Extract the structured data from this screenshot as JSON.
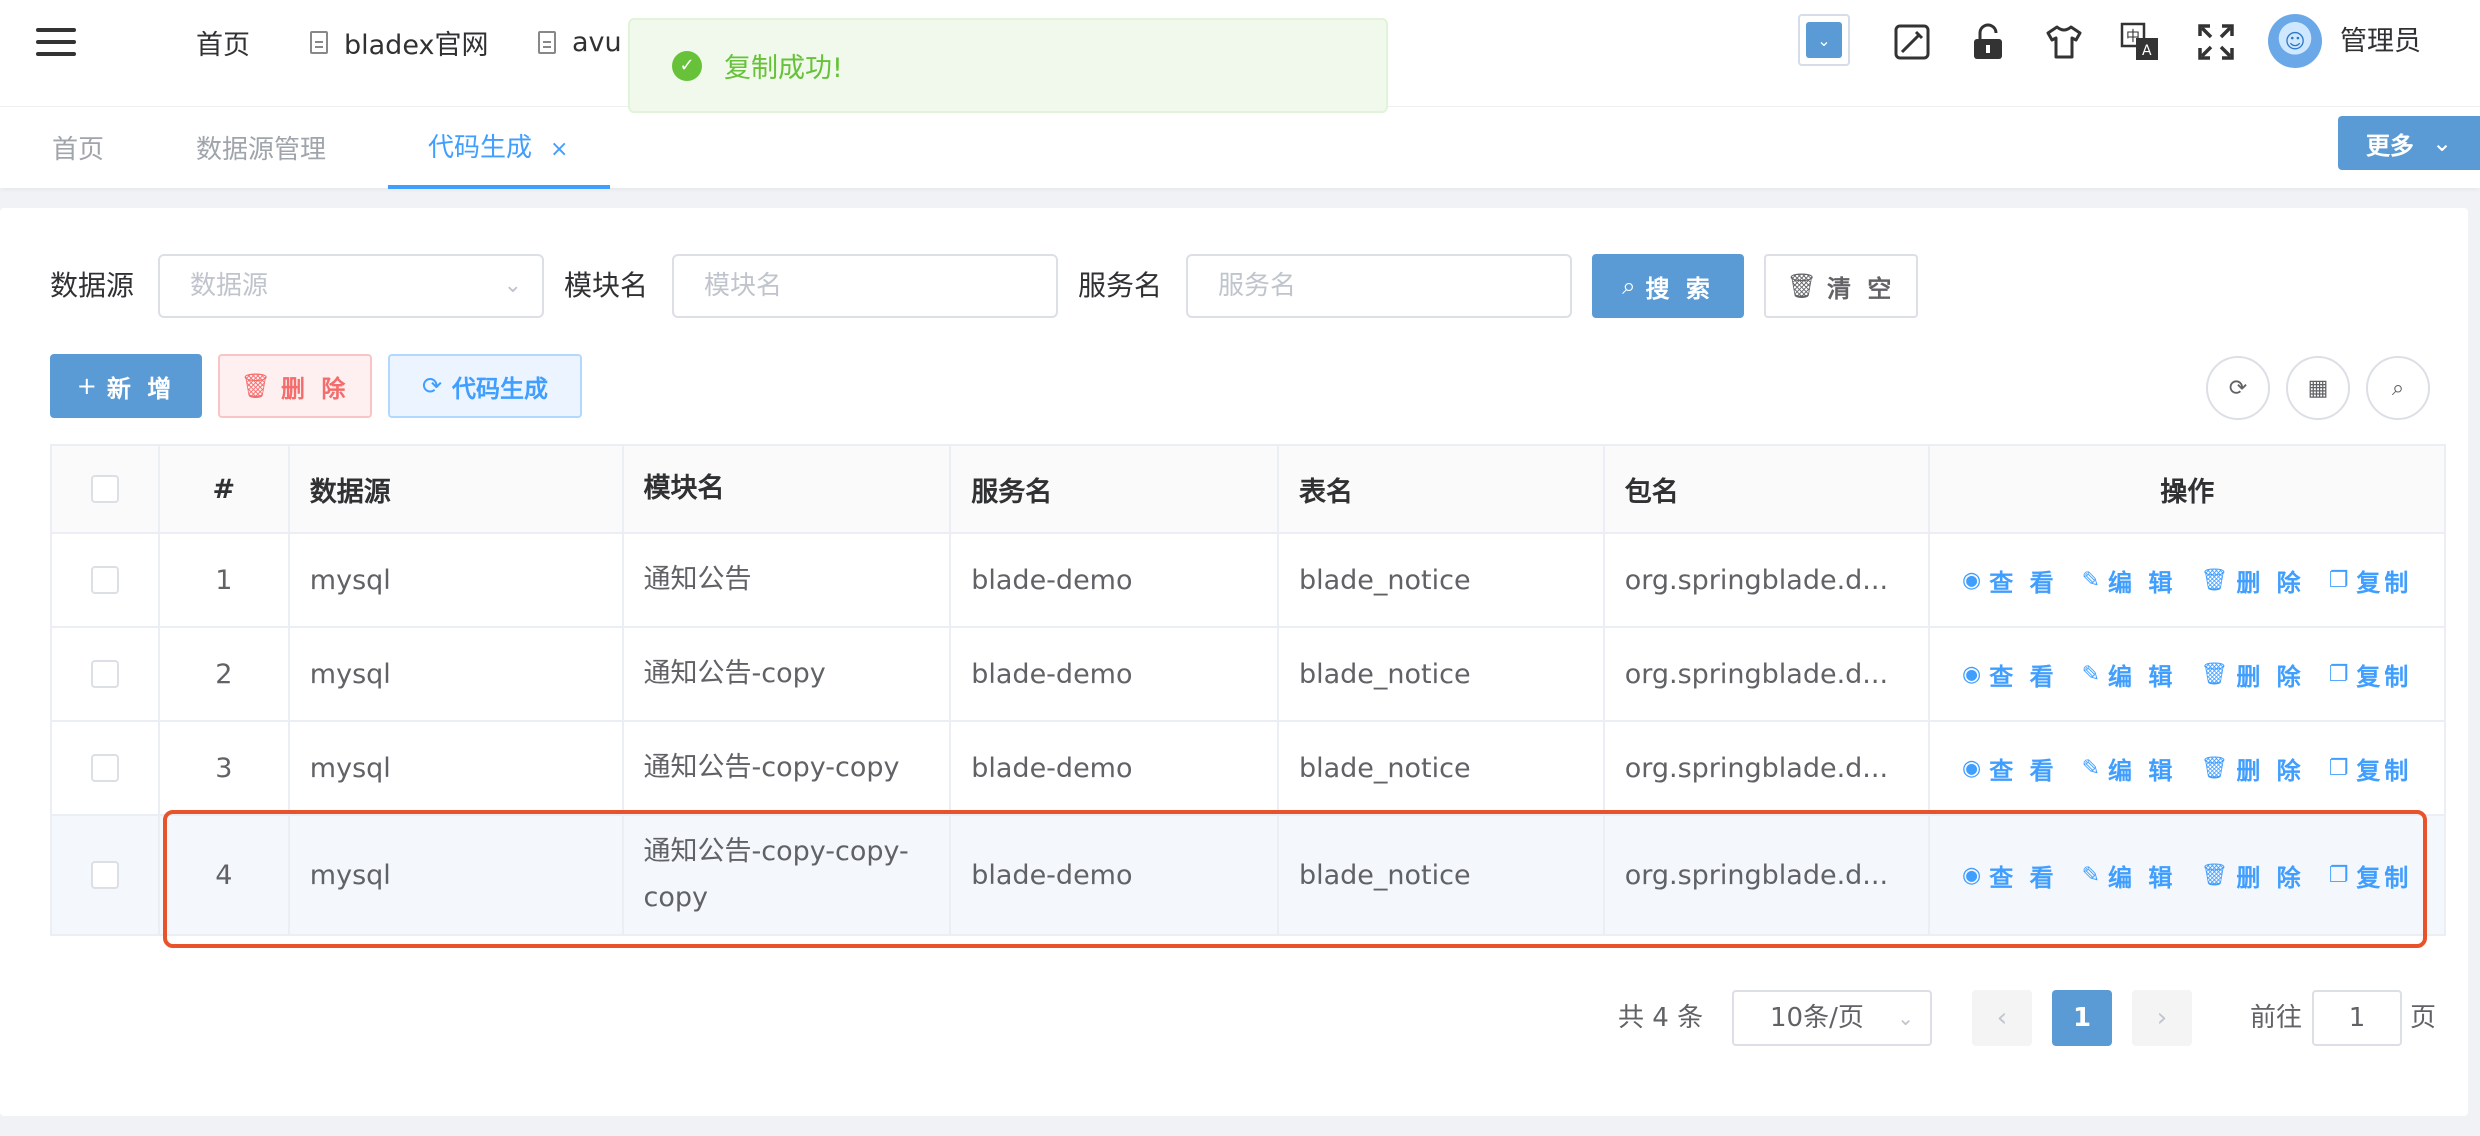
{
  "topbar": {
    "links": [
      {
        "label": "首页",
        "icon": "grid-icon"
      },
      {
        "label": "bladex官网",
        "icon": "document-icon"
      },
      {
        "label": "avu",
        "icon": "document-icon"
      }
    ],
    "user_name": "管理员",
    "icons": [
      "dropdown-icon",
      "debug-icon",
      "lock-icon",
      "theme-shirt-icon",
      "language-icon",
      "fullscreen-icon"
    ]
  },
  "toast": {
    "message": "复制成功!"
  },
  "tags": {
    "items": [
      {
        "label": "首页"
      },
      {
        "label": "数据源管理"
      },
      {
        "label": "代码生成",
        "close": "×"
      }
    ],
    "more_label": "更多"
  },
  "search": {
    "datasource_label": "数据源",
    "datasource_placeholder": "数据源",
    "module_label": "模块名",
    "module_placeholder": "模块名",
    "service_label": "服务名",
    "service_placeholder": "服务名",
    "search_button": "搜 索",
    "clear_button": "清 空"
  },
  "toolbar": {
    "add_button": "新 增",
    "delete_button": "删 除",
    "codegen_button": "代码生成"
  },
  "table": {
    "headers": [
      "#",
      "数据源",
      "模块名",
      "服务名",
      "表名",
      "包名",
      "操作"
    ],
    "rows": [
      {
        "index": "1",
        "datasource": "mysql",
        "module": "通知公告",
        "service": "blade-demo",
        "table": "blade_notice",
        "package": "org.springblade.d..."
      },
      {
        "index": "2",
        "datasource": "mysql",
        "module": "通知公告-copy",
        "service": "blade-demo",
        "table": "blade_notice",
        "package": "org.springblade.d..."
      },
      {
        "index": "3",
        "datasource": "mysql",
        "module": "通知公告-copy-copy",
        "service": "blade-demo",
        "table": "blade_notice",
        "package": "org.springblade.d..."
      },
      {
        "index": "4",
        "datasource": "mysql",
        "module": "通知公告-copy-copy-copy",
        "service": "blade-demo",
        "table": "blade_notice",
        "package": "org.springblade.d..."
      }
    ],
    "actions": {
      "view": "查 看",
      "edit": "编 辑",
      "delete": "删 除",
      "copy": "复制"
    }
  },
  "pagination": {
    "total": "共 4 条",
    "page_size": "10条/页",
    "current_page": "1",
    "goto_label": "前往",
    "goto_value": "1",
    "page_suffix": "页"
  },
  "colors": {
    "primary": "#5a9bd5",
    "link": "#409eff",
    "success": "#67c23a",
    "danger": "#f56c6c",
    "highlight_border": "#e8532b"
  }
}
